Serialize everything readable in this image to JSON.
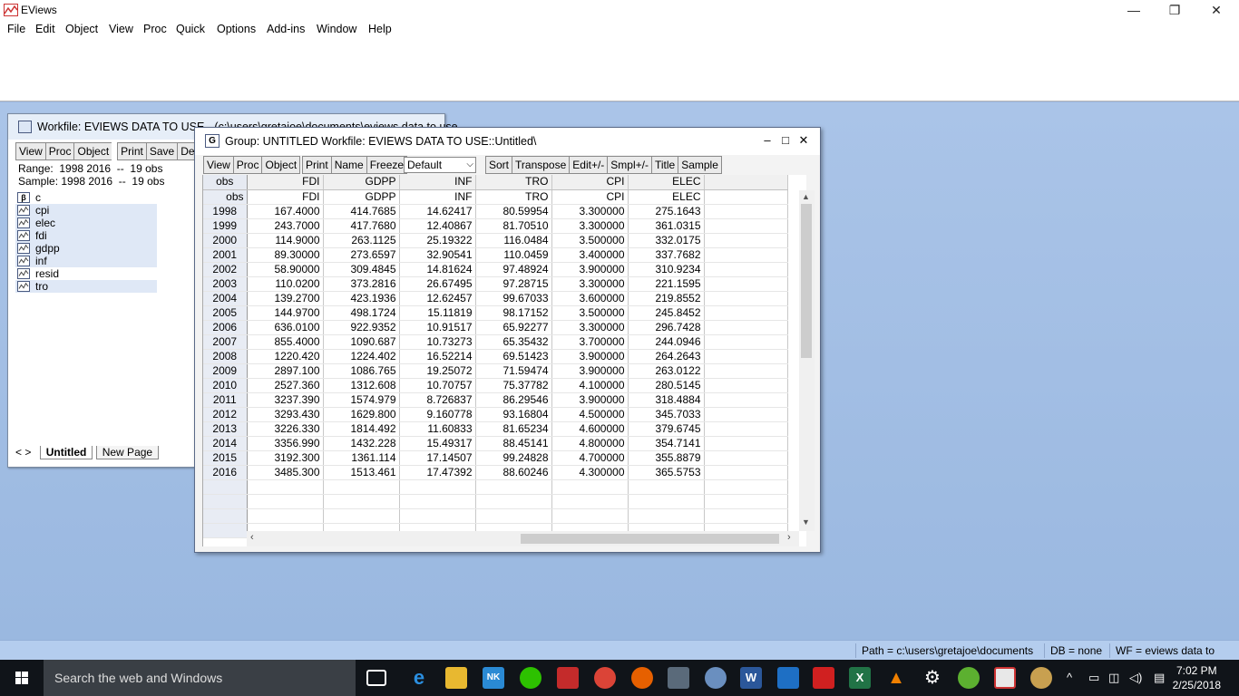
{
  "app": {
    "title": "EViews",
    "window_controls": {
      "minimize": "—",
      "restore": "❐",
      "close": "✕"
    }
  },
  "menu": [
    "File",
    "Edit",
    "Object",
    "View",
    "Proc",
    "Quick",
    "Options",
    "Add-ins",
    "Window",
    "Help"
  ],
  "workfile_window": {
    "title": "Workfile: EVIEWS DATA TO USE - (c:\\users\\gretajoe\\documents\\eviews data to use...",
    "toolbar": [
      "View",
      "Proc",
      "Object",
      "Print",
      "Save",
      "Details+/-"
    ],
    "range_line": "Range:  1998 2016  --  19 obs",
    "sample_line": "Sample: 1998 2016  --  19 obs",
    "objects": [
      {
        "name": "c",
        "icon": "coef-icon",
        "selected": false
      },
      {
        "name": "cpi",
        "icon": "series-icon",
        "selected": true
      },
      {
        "name": "elec",
        "icon": "series-icon",
        "selected": true
      },
      {
        "name": "fdi",
        "icon": "series-icon",
        "selected": true
      },
      {
        "name": "gdpp",
        "icon": "series-icon",
        "selected": true
      },
      {
        "name": "inf",
        "icon": "series-icon",
        "selected": true
      },
      {
        "name": "resid",
        "icon": "series-icon",
        "selected": false
      },
      {
        "name": "tro",
        "icon": "series-icon",
        "selected": true
      }
    ],
    "tabs": {
      "nav": "< >",
      "active": "Untitled",
      "other": "New Page"
    }
  },
  "group_window": {
    "title": "Group: UNTITLED   Workfile: EVIEWS DATA TO USE::Untitled\\",
    "icon_letter": "G",
    "controls": {
      "minimize": "–",
      "maximize": "□",
      "close": "✕"
    },
    "toolbar_left": [
      "View",
      "Proc",
      "Object"
    ],
    "toolbar_mid": [
      "Print",
      "Name",
      "Freeze"
    ],
    "format_select": "Default",
    "toolbar_right": [
      "Sort",
      "Transpose",
      "Edit+/-",
      "Smpl+/-",
      "Title",
      "Sample"
    ],
    "columns": [
      "obs",
      "FDI",
      "GDPP",
      "INF",
      "TRO",
      "CPI",
      "ELEC"
    ],
    "subheader": [
      "obs",
      "FDI",
      "GDPP",
      "INF",
      "TRO",
      "CPI",
      "ELEC"
    ],
    "rows": [
      [
        "1998",
        "167.4000",
        "414.7685",
        "14.62417",
        "80.59954",
        "3.300000",
        "275.1643"
      ],
      [
        "1999",
        "243.7000",
        "417.7680",
        "12.40867",
        "81.70510",
        "3.300000",
        "361.0315"
      ],
      [
        "2000",
        "114.9000",
        "263.1125",
        "25.19322",
        "116.0484",
        "3.500000",
        "332.0175"
      ],
      [
        "2001",
        "89.30000",
        "273.6597",
        "32.90541",
        "110.0459",
        "3.400000",
        "337.7682"
      ],
      [
        "2002",
        "58.90000",
        "309.4845",
        "14.81624",
        "97.48924",
        "3.900000",
        "310.9234"
      ],
      [
        "2003",
        "110.0200",
        "373.2816",
        "26.67495",
        "97.28715",
        "3.300000",
        "221.1595"
      ],
      [
        "2004",
        "139.2700",
        "423.1936",
        "12.62457",
        "99.67033",
        "3.600000",
        "219.8552"
      ],
      [
        "2005",
        "144.9700",
        "498.1724",
        "15.11819",
        "98.17152",
        "3.500000",
        "245.8452"
      ],
      [
        "2006",
        "636.0100",
        "922.9352",
        "10.91517",
        "65.92277",
        "3.300000",
        "296.7428"
      ],
      [
        "2007",
        "855.4000",
        "1090.687",
        "10.73273",
        "65.35432",
        "3.700000",
        "244.0946"
      ],
      [
        "2008",
        "1220.420",
        "1224.402",
        "16.52214",
        "69.51423",
        "3.900000",
        "264.2643"
      ],
      [
        "2009",
        "2897.100",
        "1086.765",
        "19.25072",
        "71.59474",
        "3.900000",
        "263.0122"
      ],
      [
        "2010",
        "2527.360",
        "1312.608",
        "10.70757",
        "75.37782",
        "4.100000",
        "280.5145"
      ],
      [
        "2011",
        "3237.390",
        "1574.979",
        "8.726837",
        "86.29546",
        "3.900000",
        "318.4884"
      ],
      [
        "2012",
        "3293.430",
        "1629.800",
        "9.160778",
        "93.16804",
        "4.500000",
        "345.7033"
      ],
      [
        "2013",
        "3226.330",
        "1814.492",
        "11.60833",
        "81.65234",
        "4.600000",
        "379.6745"
      ],
      [
        "2014",
        "3356.990",
        "1432.228",
        "15.49317",
        "88.45141",
        "4.800000",
        "354.7141"
      ],
      [
        "2015",
        "3192.300",
        "1361.114",
        "17.14507",
        "99.24828",
        "4.700000",
        "355.8879"
      ],
      [
        "2016",
        "3485.300",
        "1513.461",
        "17.47392",
        "88.60246",
        "4.300000",
        "365.5753"
      ]
    ]
  },
  "statusbar": {
    "path": "Path = c:\\users\\gretajoe\\documents",
    "db": "DB = none",
    "wf": "WF = eviews data to use"
  },
  "taskbar": {
    "search_placeholder": "Search the web and Windows",
    "time": "7:02 PM",
    "date": "2/25/2018"
  },
  "colors": {
    "desktop": "#9db8e0",
    "statusbar": "#b4cdee",
    "taskbar": "#101419"
  }
}
